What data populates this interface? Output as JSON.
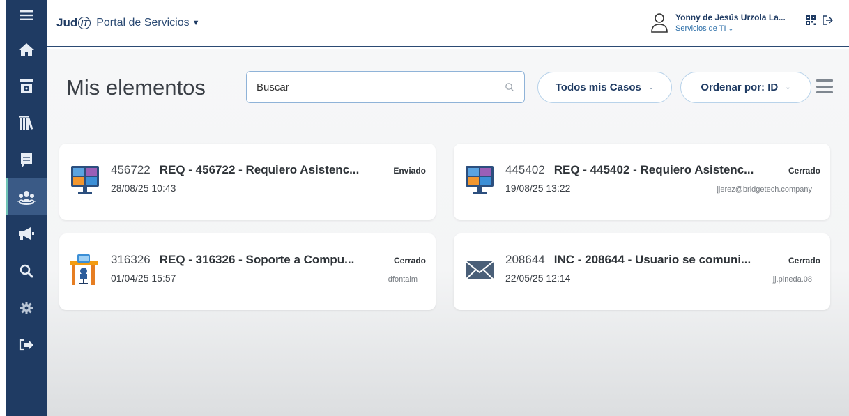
{
  "header": {
    "brand": "Jud",
    "brand_mark": "IT",
    "portal_label": "Portal de Servicios",
    "user_name": "Yonny de Jesús Urzola La...",
    "user_role": "Servicios de TI"
  },
  "sidebar": {
    "items": [
      {
        "icon": "hamburger-icon"
      },
      {
        "icon": "home-icon"
      },
      {
        "icon": "catalog-icon"
      },
      {
        "icon": "library-icon"
      },
      {
        "icon": "chat-icon"
      },
      {
        "icon": "group-icon",
        "active": true
      },
      {
        "icon": "megaphone-icon"
      },
      {
        "icon": "search-icon"
      },
      {
        "icon": "gear-icon"
      },
      {
        "icon": "logout-icon"
      }
    ]
  },
  "main": {
    "title": "Mis elementos",
    "search": {
      "value": "Buscar",
      "placeholder": "Buscar"
    },
    "filter_label": "Todos mis Casos",
    "sort_label": "Ordenar por: ID"
  },
  "cards": [
    {
      "id": "456722",
      "title": "REQ - 456722 - Requiero Asistenc...",
      "status": "Enviado",
      "date": "28/08/25 10:43",
      "user": "",
      "icon": "monitor-icon"
    },
    {
      "id": "445402",
      "title": "REQ - 445402 - Requiero Asistenc...",
      "status": "Cerrado",
      "date": "19/08/25 13:22",
      "user": "jjerez@bridgetech.company",
      "icon": "monitor-icon"
    },
    {
      "id": "316326",
      "title": "REQ - 316326 - Soporte a Compu...",
      "status": "Cerrado",
      "date": "01/04/25 15:57",
      "user": "dfontalm",
      "icon": "desk-icon"
    },
    {
      "id": "208644",
      "title": "INC - 208644 - Usuario se comuni...",
      "status": "Cerrado",
      "date": "22/05/25 12:14",
      "user": "jj.pineda.08",
      "icon": "envelope-icon"
    }
  ],
  "colors": {
    "sidebar": "#1f3b63",
    "accent": "#2b4a73",
    "active": "#6fc3b6"
  }
}
